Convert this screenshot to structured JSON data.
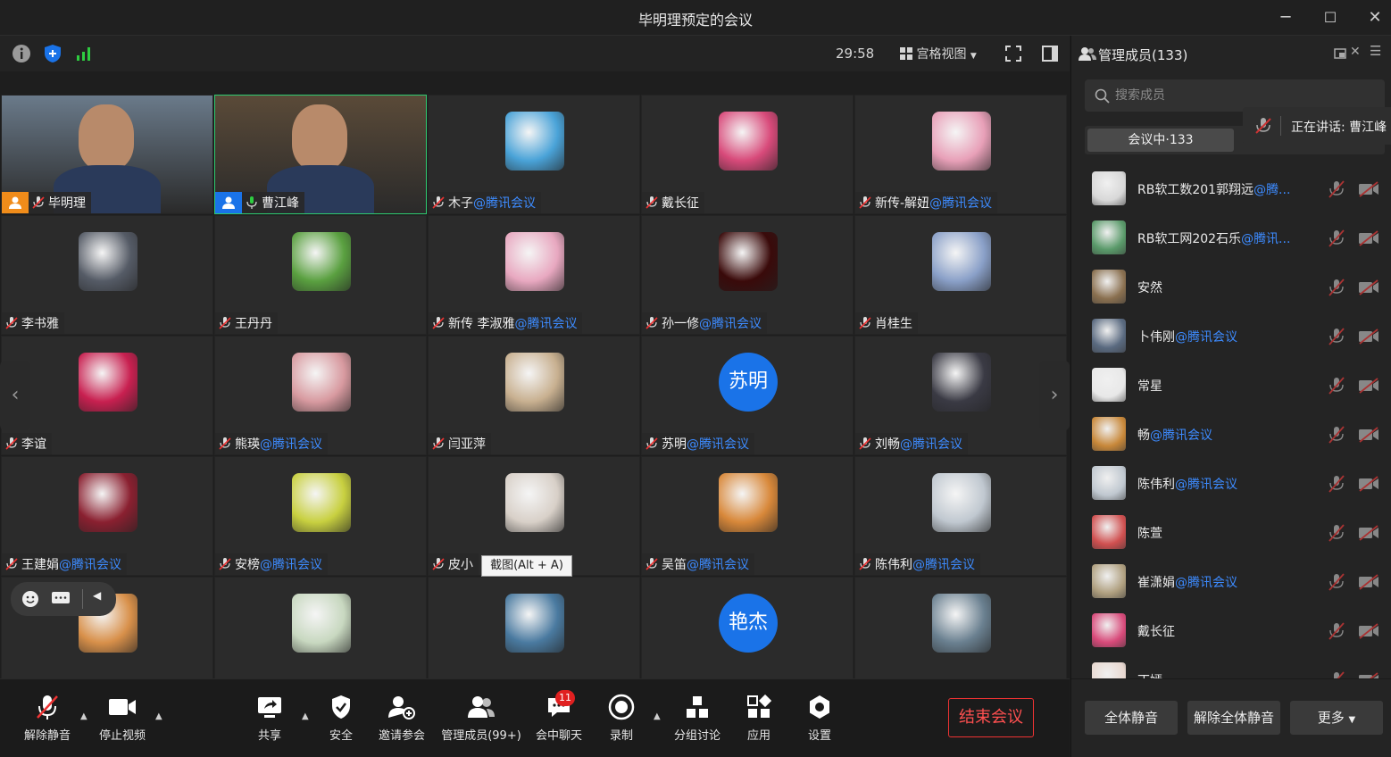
{
  "window": {
    "title": "毕明理预定的会议",
    "minimize": "─",
    "maximize": "☐",
    "close": "✕"
  },
  "infobar": {
    "timer": "29:58",
    "view_label": "宫格视图"
  },
  "grid": {
    "org_suffix": "@腾讯会议",
    "tiles": [
      {
        "name": "毕明理",
        "org": "",
        "kind": "video-host",
        "color": "#6a7a8a"
      },
      {
        "name": "曹江峰",
        "org": "",
        "kind": "video-cohost",
        "color": "#5a4a38"
      },
      {
        "name": "木子",
        "org": "@腾讯会议",
        "kind": "avatar",
        "color": "#4aa3d8"
      },
      {
        "name": "戴长征",
        "org": "",
        "kind": "avatar",
        "color": "#d84a7a"
      },
      {
        "name": "新传-解妞",
        "org": "@腾讯会议",
        "kind": "avatar",
        "color": "#e8a0b8"
      },
      {
        "name": "李书雅",
        "org": "",
        "kind": "avatar",
        "color": "#555b66"
      },
      {
        "name": "王丹丹",
        "org": "",
        "kind": "avatar",
        "color": "#5aa040"
      },
      {
        "name": "新传 李淑雅",
        "org": "@腾讯会议",
        "kind": "avatar",
        "color": "#e8a8c0"
      },
      {
        "name": "孙一修",
        "org": "@腾讯会议",
        "kind": "avatar",
        "color": "#3a0a0a"
      },
      {
        "name": "肖桂生",
        "org": "",
        "kind": "avatar",
        "color": "#8aa0c8"
      },
      {
        "name": "李谊",
        "org": "",
        "kind": "avatar",
        "color": "#c82050"
      },
      {
        "name": "熊瑛",
        "org": "@腾讯会议",
        "kind": "avatar",
        "color": "#d89aa0"
      },
      {
        "name": "闫亚萍",
        "org": "",
        "kind": "avatar",
        "color": "#c8b090"
      },
      {
        "name": "苏明",
        "org": "@腾讯会议",
        "kind": "circle",
        "initials": "苏明",
        "color": "#1a73e8"
      },
      {
        "name": "刘畅",
        "org": "@腾讯会议",
        "kind": "avatar",
        "color": "#3a3a44"
      },
      {
        "name": "王建娟",
        "org": "@腾讯会议",
        "kind": "avatar",
        "color": "#8a2030"
      },
      {
        "name": "安榜",
        "org": "@腾讯会议",
        "kind": "avatar",
        "color": "#c8d040"
      },
      {
        "name": "皮小",
        "org": "",
        "kind": "avatar",
        "color": "#d8d0c8"
      },
      {
        "name": "吴笛",
        "org": "@腾讯会议",
        "kind": "avatar",
        "color": "#d8883a"
      },
      {
        "name": "陈伟利",
        "org": "@腾讯会议",
        "kind": "avatar",
        "color": "#c0c8d0"
      },
      {
        "name": "",
        "org": "",
        "kind": "avatar",
        "color": "#d8904a"
      },
      {
        "name": "",
        "org": "",
        "kind": "avatar",
        "color": "#c8d8c0"
      },
      {
        "name": "",
        "org": "",
        "kind": "avatar",
        "color": "#4a7aa0"
      },
      {
        "name": "",
        "org": "",
        "kind": "circle",
        "initials": "艳杰",
        "color": "#1a73e8"
      },
      {
        "name": "",
        "org": "",
        "kind": "avatar",
        "color": "#6a8090"
      }
    ]
  },
  "tooltip": "截图(Alt + A)",
  "toolbar": {
    "unmute": "解除静音",
    "stop_video": "停止视频",
    "share": "共享",
    "security": "安全",
    "invite": "邀请参会",
    "manage": "管理成员(99+)",
    "chat": "会中聊天",
    "chat_badge": "11",
    "record": "录制",
    "breakout": "分组讨论",
    "apps": "应用",
    "settings": "设置",
    "end": "结束会议"
  },
  "panel": {
    "title": "管理成员(133)",
    "search_placeholder": "搜索成员",
    "speaking": "正在讲话: 曹江峰",
    "tab_in_meeting": "会议中·133",
    "members": [
      {
        "name": "RB软工数201郭翔远",
        "org": "@腾...",
        "color": "#d8d8d8"
      },
      {
        "name": "RB软工网202石乐",
        "org": "@腾讯...",
        "color": "#5a9a6a"
      },
      {
        "name": "安然",
        "org": "",
        "color": "#8a7050"
      },
      {
        "name": "卜伟刚",
        "org": "@腾讯会议",
        "color": "#5a6a80"
      },
      {
        "name": "常星",
        "org": "",
        "color": "#e8e8e8"
      },
      {
        "name": "畅",
        "org": "@腾讯会议",
        "color": "#c8883a"
      },
      {
        "name": "陈伟利",
        "org": "@腾讯会议",
        "color": "#c0c8d0"
      },
      {
        "name": "陈萱",
        "org": "",
        "color": "#d05050"
      },
      {
        "name": "崔潇娟",
        "org": "@腾讯会议",
        "color": "#b0a080"
      },
      {
        "name": "戴长征",
        "org": "",
        "color": "#d84a7a"
      },
      {
        "name": "丁嫣",
        "org": "",
        "color": "#e8d8d0"
      }
    ],
    "mute_all": "全体静音",
    "unmute_all": "解除全体静音",
    "more": "更多"
  }
}
